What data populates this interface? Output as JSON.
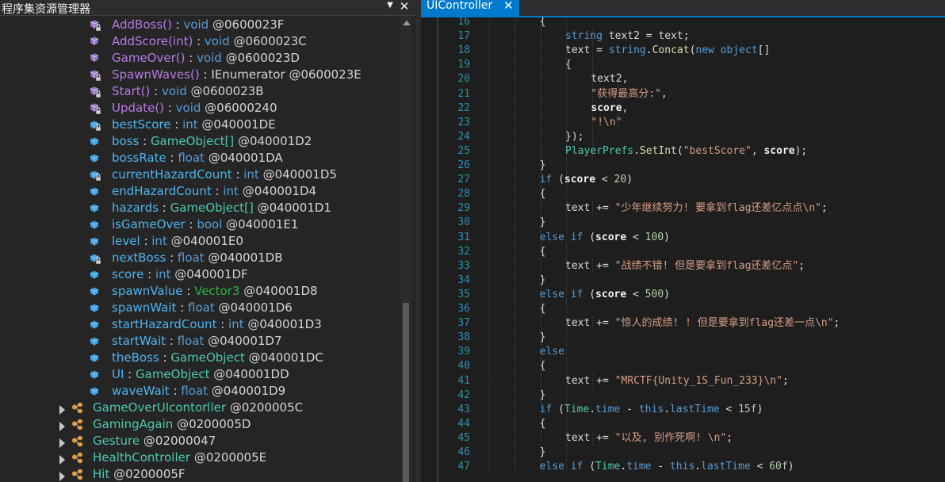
{
  "explorer": {
    "title": "程序集资源管理器",
    "dropdown_glyph": "▼",
    "close_glyph": "✕",
    "members": [
      {
        "name": "AddBoss",
        "suffix": "()",
        "type": "void",
        "type_kind": "kw",
        "token": "@0600023F",
        "kind": "method",
        "locked": true
      },
      {
        "name": "AddScore",
        "suffix": "(int)",
        "type": "void",
        "type_kind": "kw",
        "token": "@0600023C",
        "kind": "method",
        "locked": false
      },
      {
        "name": "GameOver",
        "suffix": "()",
        "type": "void",
        "type_kind": "kw",
        "token": "@0600023D",
        "kind": "method",
        "locked": false
      },
      {
        "name": "SpawnWaves",
        "suffix": "()",
        "type": "IEnumerator",
        "type_kind": "plain",
        "token": "@0600023E",
        "kind": "method",
        "locked": true
      },
      {
        "name": "Start",
        "suffix": "()",
        "type": "void",
        "type_kind": "kw",
        "token": "@0600023B",
        "kind": "method",
        "locked": true
      },
      {
        "name": "Update",
        "suffix": "()",
        "type": "void",
        "type_kind": "kw",
        "token": "@06000240",
        "kind": "method",
        "locked": true
      },
      {
        "name": "bestScore",
        "suffix": "",
        "type": "int",
        "type_kind": "kw",
        "token": "@040001DE",
        "kind": "field",
        "locked": true
      },
      {
        "name": "boss",
        "suffix": "",
        "type": "GameObject[]",
        "type_kind": "type",
        "token": "@040001D2",
        "kind": "field",
        "locked": false
      },
      {
        "name": "bossRate",
        "suffix": "",
        "type": "float",
        "type_kind": "kw",
        "token": "@040001DA",
        "kind": "field",
        "locked": false
      },
      {
        "name": "currentHazardCount",
        "suffix": "",
        "type": "int",
        "type_kind": "kw",
        "token": "@040001D5",
        "kind": "field",
        "locked": true
      },
      {
        "name": "endHazardCount",
        "suffix": "",
        "type": "int",
        "type_kind": "kw",
        "token": "@040001D4",
        "kind": "field",
        "locked": false
      },
      {
        "name": "hazards",
        "suffix": "",
        "type": "GameObject[]",
        "type_kind": "type",
        "token": "@040001D1",
        "kind": "field",
        "locked": false
      },
      {
        "name": "isGameOver",
        "suffix": "",
        "type": "bool",
        "type_kind": "kw",
        "token": "@040001E1",
        "kind": "field",
        "locked": false
      },
      {
        "name": "level",
        "suffix": "",
        "type": "int",
        "type_kind": "kw",
        "token": "@040001E0",
        "kind": "field",
        "locked": false
      },
      {
        "name": "nextBoss",
        "suffix": "",
        "type": "float",
        "type_kind": "kw",
        "token": "@040001DB",
        "kind": "field",
        "locked": true
      },
      {
        "name": "score",
        "suffix": "",
        "type": "int",
        "type_kind": "kw",
        "token": "@040001DF",
        "kind": "field",
        "locked": false
      },
      {
        "name": "spawnValue",
        "suffix": "",
        "type": "Vector3",
        "type_kind": "vec",
        "token": "@040001D8",
        "kind": "field",
        "locked": false
      },
      {
        "name": "spawnWait",
        "suffix": "",
        "type": "float",
        "type_kind": "kw",
        "token": "@040001D6",
        "kind": "field",
        "locked": false
      },
      {
        "name": "startHazardCount",
        "suffix": "",
        "type": "int",
        "type_kind": "kw",
        "token": "@040001D3",
        "kind": "field",
        "locked": false
      },
      {
        "name": "startWait",
        "suffix": "",
        "type": "float",
        "type_kind": "kw",
        "token": "@040001D7",
        "kind": "field",
        "locked": false
      },
      {
        "name": "theBoss",
        "suffix": "",
        "type": "GameObject",
        "type_kind": "type",
        "token": "@040001DC",
        "kind": "field",
        "locked": false
      },
      {
        "name": "UI",
        "suffix": "",
        "type": "GameObject",
        "type_kind": "type",
        "token": "@040001DD",
        "kind": "field",
        "locked": false
      },
      {
        "name": "waveWait",
        "suffix": "",
        "type": "float",
        "type_kind": "kw",
        "token": "@040001D9",
        "kind": "field",
        "locked": false
      }
    ],
    "classes": [
      {
        "name": "GameOverUIcontorller",
        "token": "@0200005C"
      },
      {
        "name": "GamingAgain",
        "token": "@0200005D"
      },
      {
        "name": "Gesture",
        "token": "@02000047"
      },
      {
        "name": "HealthController",
        "token": "@0200005E"
      },
      {
        "name": "Hit",
        "token": "@0200005F"
      }
    ]
  },
  "editor": {
    "tab_label": "UIController",
    "tab_close_glyph": "✕",
    "lines": [
      {
        "n": "16",
        "indent": 4,
        "tokens": [
          [
            "p",
            "{"
          ]
        ]
      },
      {
        "n": "17",
        "indent": 5,
        "tokens": [
          [
            "kw",
            "string"
          ],
          [
            "p",
            " text2 = text;"
          ]
        ]
      },
      {
        "n": "18",
        "indent": 5,
        "tokens": [
          [
            "p",
            "text = "
          ],
          [
            "kw",
            "string"
          ],
          [
            "p",
            "."
          ],
          [
            "fn",
            "Concat"
          ],
          [
            "p",
            "("
          ],
          [
            "kw",
            "new"
          ],
          [
            "p",
            " "
          ],
          [
            "kw",
            "object"
          ],
          [
            "p",
            "[]"
          ]
        ]
      },
      {
        "n": "19",
        "indent": 5,
        "tokens": [
          [
            "p",
            "{"
          ]
        ]
      },
      {
        "n": "20",
        "indent": 6,
        "tokens": [
          [
            "p",
            "text2,"
          ]
        ]
      },
      {
        "n": "21",
        "indent": 6,
        "tokens": [
          [
            "str",
            "\"获得最高分:\""
          ],
          [
            "p",
            ","
          ]
        ]
      },
      {
        "n": "22",
        "indent": 6,
        "tokens": [
          [
            "b",
            "score"
          ],
          [
            "p",
            ","
          ]
        ]
      },
      {
        "n": "23",
        "indent": 6,
        "tokens": [
          [
            "str",
            "\"!\\n\""
          ]
        ]
      },
      {
        "n": "24",
        "indent": 5,
        "tokens": [
          [
            "p",
            "});"
          ]
        ]
      },
      {
        "n": "25",
        "indent": 5,
        "tokens": [
          [
            "type",
            "PlayerPrefs"
          ],
          [
            "p",
            "."
          ],
          [
            "fn",
            "SetInt"
          ],
          [
            "p",
            "("
          ],
          [
            "str",
            "\"bestScore\""
          ],
          [
            "p",
            ", "
          ],
          [
            "b",
            "score"
          ],
          [
            "p",
            ");"
          ]
        ]
      },
      {
        "n": "26",
        "indent": 4,
        "tokens": [
          [
            "p",
            "}"
          ]
        ]
      },
      {
        "n": "27",
        "indent": 4,
        "tokens": [
          [
            "kw",
            "if"
          ],
          [
            "p",
            " ("
          ],
          [
            "b",
            "score"
          ],
          [
            "p",
            " < "
          ],
          [
            "num",
            "20"
          ],
          [
            "p",
            ")"
          ]
        ]
      },
      {
        "n": "28",
        "indent": 4,
        "tokens": [
          [
            "p",
            "{"
          ]
        ]
      },
      {
        "n": "29",
        "indent": 5,
        "tokens": [
          [
            "p",
            "text += "
          ],
          [
            "str",
            "\"少年继续努力! 要拿到flag还差亿点点\\n\""
          ],
          [
            "p",
            ";"
          ]
        ]
      },
      {
        "n": "30",
        "indent": 4,
        "tokens": [
          [
            "p",
            "}"
          ]
        ]
      },
      {
        "n": "31",
        "indent": 4,
        "tokens": [
          [
            "kw",
            "else if"
          ],
          [
            "p",
            " ("
          ],
          [
            "b",
            "score"
          ],
          [
            "p",
            " < "
          ],
          [
            "num",
            "100"
          ],
          [
            "p",
            ")"
          ]
        ]
      },
      {
        "n": "32",
        "indent": 4,
        "tokens": [
          [
            "p",
            "{"
          ]
        ]
      },
      {
        "n": "33",
        "indent": 5,
        "tokens": [
          [
            "p",
            "text += "
          ],
          [
            "str",
            "\"战绩不错! 但是要拿到flag还差亿点\""
          ],
          [
            "p",
            ";"
          ]
        ]
      },
      {
        "n": "34",
        "indent": 4,
        "tokens": [
          [
            "p",
            "}"
          ]
        ]
      },
      {
        "n": "35",
        "indent": 4,
        "tokens": [
          [
            "kw",
            "else if"
          ],
          [
            "p",
            " ("
          ],
          [
            "b",
            "score"
          ],
          [
            "p",
            " < "
          ],
          [
            "num",
            "500"
          ],
          [
            "p",
            ")"
          ]
        ]
      },
      {
        "n": "36",
        "indent": 4,
        "tokens": [
          [
            "p",
            "{"
          ]
        ]
      },
      {
        "n": "37",
        "indent": 5,
        "tokens": [
          [
            "p",
            "text += "
          ],
          [
            "str",
            "\"惊人的成绩! ! 但是要拿到flag还差一点\\n\""
          ],
          [
            "p",
            ";"
          ]
        ]
      },
      {
        "n": "38",
        "indent": 4,
        "tokens": [
          [
            "p",
            "}"
          ]
        ]
      },
      {
        "n": "39",
        "indent": 4,
        "tokens": [
          [
            "kw",
            "else"
          ]
        ]
      },
      {
        "n": "40",
        "indent": 4,
        "tokens": [
          [
            "p",
            "{"
          ]
        ]
      },
      {
        "n": "41",
        "indent": 5,
        "tokens": [
          [
            "p",
            "text += "
          ],
          [
            "str",
            "\"MRCTF{Unity_1S_Fun_233}\\n\""
          ],
          [
            "p",
            ";"
          ]
        ]
      },
      {
        "n": "42",
        "indent": 4,
        "tokens": [
          [
            "p",
            "}"
          ]
        ]
      },
      {
        "n": "43",
        "indent": 4,
        "tokens": [
          [
            "kw",
            "if"
          ],
          [
            "p",
            " ("
          ],
          [
            "type",
            "Time"
          ],
          [
            "p",
            "."
          ],
          [
            "kw",
            "time"
          ],
          [
            "p",
            " - "
          ],
          [
            "kw",
            "this"
          ],
          [
            "p",
            "."
          ],
          [
            "kw",
            "lastTime"
          ],
          [
            "p",
            " < "
          ],
          [
            "num",
            "15f"
          ],
          [
            "p",
            ")"
          ]
        ]
      },
      {
        "n": "44",
        "indent": 4,
        "tokens": [
          [
            "p",
            "{"
          ]
        ]
      },
      {
        "n": "45",
        "indent": 5,
        "tokens": [
          [
            "p",
            "text += "
          ],
          [
            "str",
            "\"以及, 别作死啊! \\n\""
          ],
          [
            "p",
            ";"
          ]
        ]
      },
      {
        "n": "46",
        "indent": 4,
        "tokens": [
          [
            "p",
            "}"
          ]
        ]
      },
      {
        "n": "47",
        "indent": 4,
        "tokens": [
          [
            "kw",
            "else if"
          ],
          [
            "p",
            " ("
          ],
          [
            "type",
            "Time"
          ],
          [
            "p",
            "."
          ],
          [
            "kw",
            "time"
          ],
          [
            "p",
            " - "
          ],
          [
            "kw",
            "this"
          ],
          [
            "p",
            "."
          ],
          [
            "kw",
            "lastTime"
          ],
          [
            "p",
            " < "
          ],
          [
            "num",
            "60f"
          ],
          [
            "p",
            ")"
          ]
        ]
      }
    ]
  }
}
